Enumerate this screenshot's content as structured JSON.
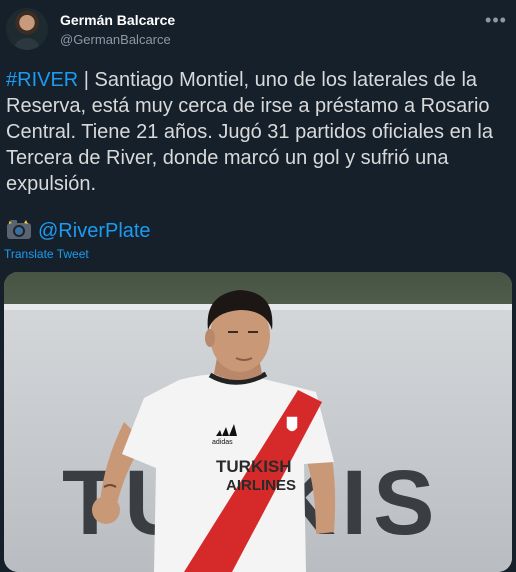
{
  "author": {
    "name": "Germán Balcarce",
    "handle": "@GermanBalcarce"
  },
  "tweet": {
    "hashtag": "#RIVER",
    "body": " | Santiago Montiel, uno de los laterales de la Reserva, está muy cerca de irse a préstamo a Rosario Central. Tiene 21 años. Jugó 31 partidos oficiales en la Tercera de River, donde marcó un gol y sufrió una expulsión.",
    "mention": "@RiverPlate",
    "translate_label": "Translate Tweet"
  },
  "media": {
    "banner_text": "TURKIS",
    "jersey_line1": "TURKISH",
    "jersey_line2": "AIRLINES",
    "sleeve_brand": "adidas"
  },
  "icons": [
    "avatar",
    "more-icon",
    "camera-icon"
  ],
  "colors": {
    "background": "#15202b",
    "link": "#1d9bf0",
    "secondary_text": "#8b98a5",
    "sash_red": "#d62a2a"
  }
}
